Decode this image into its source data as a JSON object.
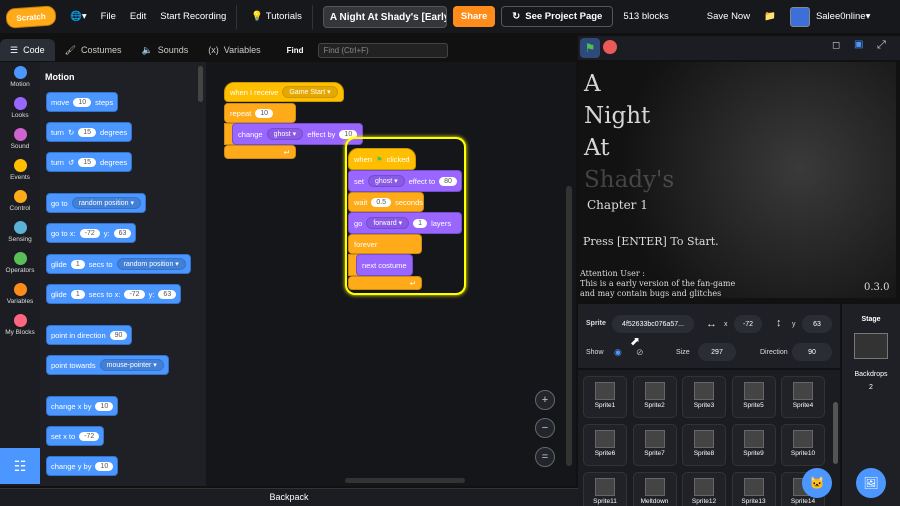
{
  "menubar": {
    "logo": "Scratch",
    "file": "File",
    "edit": "Edit",
    "start_recording": "Start Recording",
    "tutorials": "Tutorials",
    "project_title": "A Night At Shady's [Early ...",
    "share": "Share",
    "see_project_page": "See Project Page",
    "block_count": "513 blocks",
    "save_now": "Save Now",
    "username": "Salee0nline"
  },
  "tabs": {
    "code": "Code",
    "costumes": "Costumes",
    "sounds": "Sounds",
    "variables": "Variables",
    "find": "Find",
    "find_placeholder": "Find (Ctrl+F)"
  },
  "categories": [
    {
      "label": "Motion",
      "color": "#4c97ff"
    },
    {
      "label": "Looks",
      "color": "#9966ff"
    },
    {
      "label": "Sound",
      "color": "#cf63cf"
    },
    {
      "label": "Events",
      "color": "#ffbf00"
    },
    {
      "label": "Control",
      "color": "#ffab19"
    },
    {
      "label": "Sensing",
      "color": "#5cb1d6"
    },
    {
      "label": "Operators",
      "color": "#59c059"
    },
    {
      "label": "Variables",
      "color": "#ff8c1a"
    },
    {
      "label": "My Blocks",
      "color": "#ff6680"
    }
  ],
  "palette": {
    "heading": "Motion",
    "move": "move",
    "move_val": "10",
    "steps": "steps",
    "turn": "turn",
    "turn_r_val": "15",
    "degrees": "degrees",
    "turn_l_val": "15",
    "goto": "go to",
    "goto_dd": "random position",
    "gotoxy": "go to x:",
    "gotoxy_x": "-72",
    "y": "y:",
    "gotoxy_y": "63",
    "glide": "glide",
    "glide1_val": "1",
    "secs_to": "secs to",
    "glide1_dd": "random position",
    "glide2_val": "1",
    "secs_to_x": "secs to x:",
    "glide2_x": "-72",
    "glide2_y": "63",
    "point_dir": "point in direction",
    "point_dir_val": "90",
    "point_towards": "point towards",
    "point_towards_dd": "mouse-pointer",
    "change_x": "change x by",
    "change_x_val": "10",
    "set_x": "set x to",
    "set_x_val": "-72",
    "change_y": "change y by",
    "change_y_val": "10"
  },
  "script1": {
    "when_receive": "when I receive",
    "msg": "Game Start",
    "repeat": "repeat",
    "repeat_val": "10",
    "change": "change",
    "effect": "ghost",
    "effect_by": "effect by",
    "effect_val": "10"
  },
  "script2": {
    "when": "when",
    "clicked": "clicked",
    "set": "set",
    "set_effect": "ghost",
    "effect_to": "effect to",
    "set_val": "80",
    "wait": "wait",
    "wait_val": "0.5",
    "seconds": "seconds",
    "go": "go",
    "go_dd": "forward",
    "go_val": "1",
    "layers": "layers",
    "forever": "forever",
    "next_costume": "next costume"
  },
  "backpack": "Backpack",
  "stage": {
    "t1": "A",
    "t2": "Night",
    "t3": "At",
    "t4": "Shady's",
    "chapter": "Chapter 1",
    "press": "Press [ENTER] To Start.",
    "attn": "Attention User :",
    "note1": "This is a early version of the fan-game",
    "note2": "and may contain bugs and glitches",
    "version": "0.3.0"
  },
  "sprite_info": {
    "sprite_label": "Sprite",
    "sprite_name": "4f52633bc076a57...",
    "x_label": "x",
    "x_val": "-72",
    "y_label": "y",
    "y_val": "63",
    "show": "Show",
    "size_label": "Size",
    "size_val": "297",
    "direction_label": "Direction",
    "direction_val": "90"
  },
  "sprites": [
    "Sprite1",
    "Sprite2",
    "Sprite3",
    "Sprite5",
    "Sprite4",
    "Sprite6",
    "Sprite7",
    "Sprite8",
    "Sprite9",
    "Sprite10",
    "Sprite11",
    "Meltdown",
    "Sprite12",
    "Sprite13",
    "Sprite14"
  ],
  "stage_pane": {
    "label": "Stage",
    "backdrops": "Backdrops",
    "backdrops_count": "2"
  }
}
